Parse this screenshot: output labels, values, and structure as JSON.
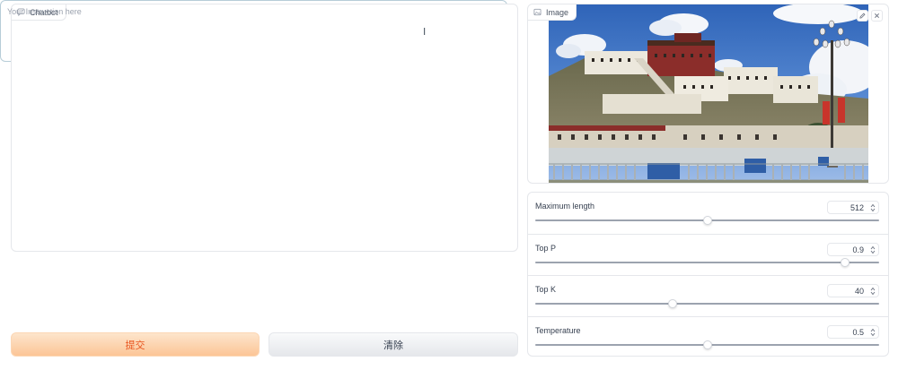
{
  "chatbot": {
    "label": "Chatbot"
  },
  "instruction": {
    "placeholder": "Your Instruction here",
    "value": ""
  },
  "buttons": {
    "submit": "提交",
    "clear": "清除"
  },
  "image_panel": {
    "label": "Image"
  },
  "controls": [
    {
      "label": "Maximum length",
      "value": "512",
      "fraction": 0.5
    },
    {
      "label": "Top P",
      "value": "0.9",
      "fraction": 0.9
    },
    {
      "label": "Top K",
      "value": "40",
      "fraction": 0.4
    },
    {
      "label": "Temperature",
      "value": "0.5",
      "fraction": 0.5
    }
  ],
  "colors": {
    "accent": "#e8551f",
    "submit_bg": "#fcc596",
    "sky": "#3f73c4"
  }
}
